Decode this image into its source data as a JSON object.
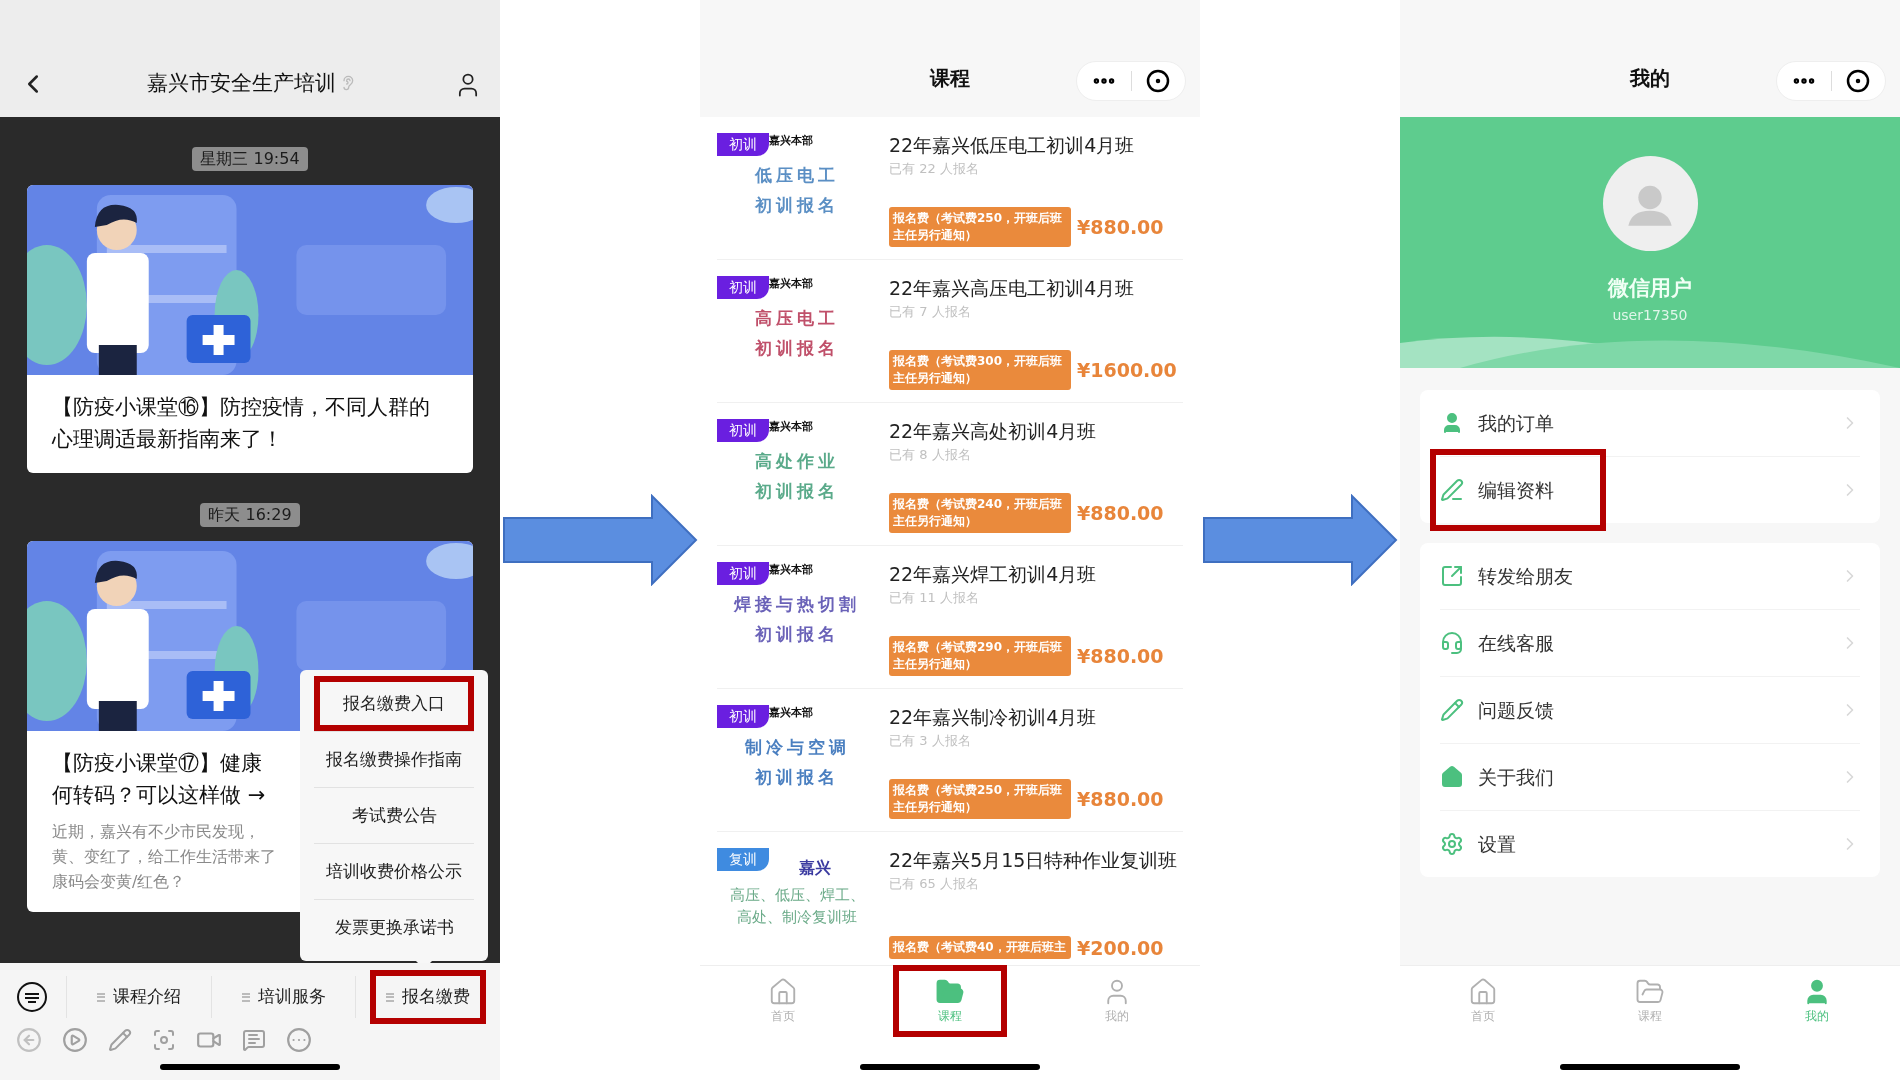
{
  "chat_screen": {
    "header": {
      "title": "嘉兴市安全生产培训"
    },
    "messages": [
      {
        "time": "星期三 19:54",
        "title_lines": [
          "【防疫小课堂⑯】防控疫情，不同人群的心理调适最新指南来了！"
        ]
      },
      {
        "time": "昨天 16:29",
        "title_lines": [
          "【防疫小课堂⑰】健康",
          "何转码？可以这样做 →"
        ],
        "summary_lines": [
          "近期，嘉兴有不少市民发现，",
          "黄、变红了，给工作生活带来了",
          "康码会变黄/红色？"
        ]
      }
    ],
    "popup_menu": {
      "items": [
        {
          "label": "报名缴费入口",
          "highlighted": true
        },
        {
          "label": "报名缴费操作指南",
          "highlighted": false
        },
        {
          "label": "考试费公告",
          "highlighted": false
        },
        {
          "label": "培训收费价格公示",
          "highlighted": false
        },
        {
          "label": "发票更换承诺书",
          "highlighted": false
        }
      ]
    },
    "menu_bar": {
      "items": [
        {
          "label": "课程介绍",
          "highlighted": false
        },
        {
          "label": "培训服务",
          "highlighted": false
        },
        {
          "label": "报名缴费",
          "highlighted": true
        }
      ]
    }
  },
  "course_screen": {
    "header": {
      "title": "课程"
    },
    "courses": [
      {
        "kind": "initial",
        "badge": "初训",
        "campus": "嘉兴本部",
        "thumb_lines": [
          "低压电工",
          "初训报名"
        ],
        "color": "#5b8fc4",
        "title": "22年嘉兴低压电工初训4月班",
        "enrolled": "已有 22 人报名",
        "fee_note": "报名费（考试费250，开班后班主任另行通知）",
        "price": "¥880.00"
      },
      {
        "kind": "initial",
        "badge": "初训",
        "campus": "嘉兴本部",
        "thumb_lines": [
          "高压电工",
          "初训报名"
        ],
        "color": "#c0506a",
        "title": "22年嘉兴高压电工初训4月班",
        "enrolled": "已有 7 人报名",
        "fee_note": "报名费（考试费300，开班后班主任另行通知）",
        "price": "¥1600.00"
      },
      {
        "kind": "initial",
        "badge": "初训",
        "campus": "嘉兴本部",
        "thumb_lines": [
          "高处作业",
          "初训报名"
        ],
        "color": "#5aaa8a",
        "title": "22年嘉兴高处初训4月班",
        "enrolled": "已有 8 人报名",
        "fee_note": "报名费（考试费240，开班后班主任另行通知）",
        "price": "¥880.00"
      },
      {
        "kind": "initial",
        "badge": "初训",
        "campus": "嘉兴本部",
        "thumb_lines": [
          "焊接与热切割",
          "初训报名"
        ],
        "color": "#6a62b8",
        "title": "22年嘉兴焊工初训4月班",
        "enrolled": "已有 11 人报名",
        "fee_note": "报名费（考试费290，开班后班主任另行通知）",
        "price": "¥880.00"
      },
      {
        "kind": "initial",
        "badge": "初训",
        "campus": "嘉兴本部",
        "thumb_lines": [
          "制冷与空调",
          "初训报名"
        ],
        "color": "#4a7fc0",
        "title": "22年嘉兴制冷初训4月班",
        "enrolled": "已有 3 人报名",
        "fee_note": "报名费（考试费250，开班后班主任另行通知）",
        "price": "¥880.00"
      },
      {
        "kind": "refresher",
        "badge": "复训",
        "campus": "嘉兴",
        "thumb_lines": [
          "高压、低压、焊工、",
          "高处、制冷复训班"
        ],
        "color": "#6aaa88",
        "title": "22年嘉兴5月15日特种作业复训班",
        "enrolled": "已有 65 人报名",
        "fee_note": "报名费（考试费40，开班后班主",
        "price": "¥200.00"
      }
    ],
    "tab_bar": {
      "items": [
        {
          "label": "首页",
          "selected": false,
          "highlighted": false
        },
        {
          "label": "课程",
          "selected": true,
          "highlighted": true
        },
        {
          "label": "我的",
          "selected": false,
          "highlighted": false
        }
      ]
    }
  },
  "profile_screen": {
    "header": {
      "title": "我的"
    },
    "profile": {
      "name": "微信用户",
      "user_id": "user17350"
    },
    "menu_groups": [
      {
        "items": [
          {
            "label": "我的订单",
            "highlighted": false
          },
          {
            "label": "编辑资料",
            "highlighted": true
          }
        ]
      },
      {
        "items": [
          {
            "label": "转发给朋友",
            "highlighted": false
          },
          {
            "label": "在线客服",
            "highlighted": false
          },
          {
            "label": "问题反馈",
            "highlighted": false
          },
          {
            "label": "关于我们",
            "highlighted": false
          },
          {
            "label": "设置",
            "highlighted": false
          }
        ]
      }
    ],
    "tab_bar": {
      "items": [
        {
          "label": "首页",
          "selected": false,
          "highlighted": false
        },
        {
          "label": "课程",
          "selected": false,
          "highlighted": false
        },
        {
          "label": "我的",
          "selected": true,
          "highlighted": false
        }
      ]
    }
  }
}
